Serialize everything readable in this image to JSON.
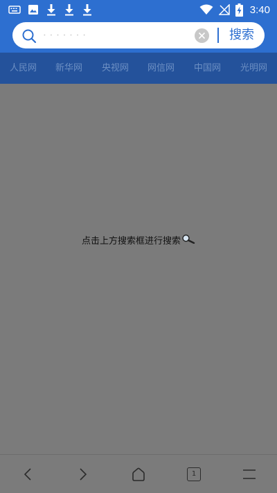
{
  "status_bar": {
    "time": "3:40",
    "left_icons": [
      "keyboard-icon",
      "image-icon",
      "download-icon",
      "download-icon",
      "download-icon"
    ],
    "right_icons": [
      "wifi-icon",
      "no-signal-icon",
      "battery-charging-icon"
    ]
  },
  "search": {
    "value": "",
    "placeholder": "· · · · · · ·",
    "button_label": "搜索"
  },
  "tabs": [
    {
      "label": "人民网"
    },
    {
      "label": "新华网"
    },
    {
      "label": "央视网"
    },
    {
      "label": "网信网"
    },
    {
      "label": "中国网"
    },
    {
      "label": "光明网"
    }
  ],
  "content": {
    "hint": "点击上方搜索框进行搜索",
    "hint_icon": "magnifier-icon"
  },
  "bottom_nav": {
    "tab_count": "1",
    "buttons": [
      "back-icon",
      "forward-icon",
      "home-icon",
      "tabs-icon",
      "menu-icon"
    ]
  },
  "colors": {
    "accent": "#2d6fd0",
    "tabs_bg": "#24529b",
    "overlay_bg": "#7b7b7b"
  }
}
